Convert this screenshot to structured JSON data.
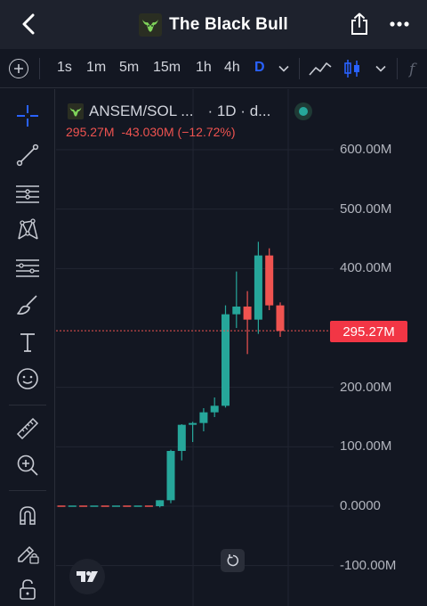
{
  "header": {
    "title": "The Black Bull",
    "back_icon": "chevron-left-icon",
    "share_icon": "share-icon",
    "more_icon": "more-horizontal-icon"
  },
  "toolbar": {
    "intervals": [
      "1s",
      "1m",
      "5m",
      "15m",
      "1h",
      "4h",
      "D"
    ],
    "active_interval": "D",
    "icons": [
      "add-circle-icon",
      "chevron-down-icon",
      "indicators-icon",
      "candles-icon",
      "chevron-down-icon",
      "fx-icon"
    ]
  },
  "sidebar": {
    "tools": [
      "crosshair-icon",
      "trendline-icon",
      "horizontal-lines-icon",
      "pattern-icon",
      "fib-levels-icon",
      "brush-icon",
      "text-icon",
      "emoji-icon",
      "ruler-icon",
      "zoom-in-icon",
      "magnet-icon",
      "lock-pencil-icon",
      "lock-icon"
    ]
  },
  "legend": {
    "symbol": "ANSEM/SOL ...",
    "details": "· 1D · d...",
    "last": "295.27M",
    "change": "-43.030M",
    "change_pct": "(−12.72%)"
  },
  "colors": {
    "up": "#26a69a",
    "down": "#ef5350",
    "accent": "#2962ff",
    "background": "#131722"
  },
  "chart_data": {
    "type": "candlestick",
    "y_axis_labels": [
      "600.00M",
      "500.00M",
      "400.00M",
      "200.00M",
      "100.00M",
      "0.0000",
      "-100.00M"
    ],
    "current_price_label": "295.27M",
    "ylim": [
      -110,
      660
    ],
    "y_unit": "M",
    "candles": [
      {
        "o": 0,
        "h": 0,
        "l": 0,
        "c": 0
      },
      {
        "o": 0,
        "h": 0,
        "l": 0,
        "c": 0
      },
      {
        "o": 0,
        "h": 0,
        "l": 0,
        "c": 0
      },
      {
        "o": 0,
        "h": 0,
        "l": 0,
        "c": 0
      },
      {
        "o": 0,
        "h": 0,
        "l": 0,
        "c": 0
      },
      {
        "o": 0,
        "h": 0,
        "l": 0,
        "c": 0
      },
      {
        "o": 0,
        "h": 0,
        "l": 0,
        "c": 0
      },
      {
        "o": 0,
        "h": 0,
        "l": 0,
        "c": 0
      },
      {
        "o": 0,
        "h": 0,
        "l": 0,
        "c": 0
      },
      {
        "o": 0,
        "h": 10,
        "l": -2,
        "c": 10
      },
      {
        "o": 10,
        "h": 95,
        "l": 5,
        "c": 93
      },
      {
        "o": 93,
        "h": 138,
        "l": 77,
        "c": 137
      },
      {
        "o": 137,
        "h": 142,
        "l": 108,
        "c": 140
      },
      {
        "o": 140,
        "h": 165,
        "l": 126,
        "c": 158
      },
      {
        "o": 158,
        "h": 183,
        "l": 150,
        "c": 169
      },
      {
        "o": 169,
        "h": 338,
        "l": 166,
        "c": 323
      },
      {
        "o": 323,
        "h": 395,
        "l": 300,
        "c": 336
      },
      {
        "o": 336,
        "h": 362,
        "l": 256,
        "c": 314
      },
      {
        "o": 314,
        "h": 445,
        "l": 290,
        "c": 422
      },
      {
        "o": 422,
        "h": 434,
        "l": 330,
        "c": 338
      },
      {
        "o": 338,
        "h": 343,
        "l": 285,
        "c": 295
      }
    ]
  }
}
